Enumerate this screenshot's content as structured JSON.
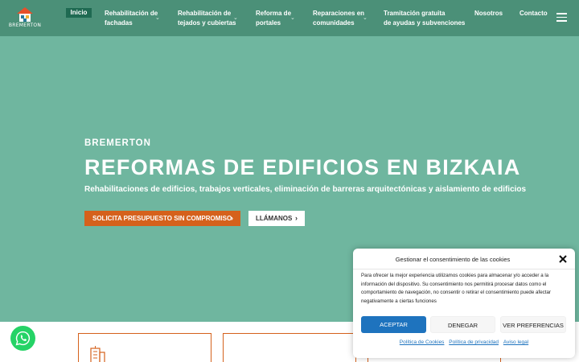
{
  "brand": {
    "logo_text": "BREMERTON"
  },
  "nav": {
    "items": [
      {
        "label": "Inicio",
        "active": true
      },
      {
        "label_line1": "Rehabilitación de",
        "label_line2": "fachadas",
        "has_submenu": true
      },
      {
        "label_line1": "Rehabilitación de",
        "label_line2": "tejados y cubiertas",
        "has_submenu": true
      },
      {
        "label_line1": "Reforma de",
        "label_line2": "portales",
        "has_submenu": true
      },
      {
        "label_line1": "Reparaciones en",
        "label_line2": "comunidades",
        "has_submenu": true
      },
      {
        "label_line1": "Tramitación gratuita",
        "label_line2": "de ayudas y subvenciones",
        "has_submenu": false
      },
      {
        "label": "Nosotros"
      },
      {
        "label": "Contacto"
      }
    ],
    "menu_icon": "hamburger-icon"
  },
  "hero": {
    "eyebrow": "BREMERTON",
    "title": "REFORMAS DE EDIFICIOS EN BIZKAIA",
    "subtitle": "Rehabilitaciones de edificios, trabajos verticales, eliminación de barreras arquitectónicas y aislamiento de edificios",
    "cta_primary": "SOLICITA PRESUPUESTO SIN COMPROMISO",
    "cta_secondary": "LLÁMANOS",
    "arrow": "›"
  },
  "cookie_banner": {
    "title": "Gestionar el consentimiento de las cookies",
    "body": "Para ofrecer la mejor experiencia utilizamos cookies para almacenar y/o acceder a la información del dispositivo. Su consentimiento nos permitirá procesar datos como el comportamiento de navegación, no consentir o retirar el consentimiento puede afectar negativamente a ciertas funciones",
    "accept": "ACEPTAR",
    "deny": "DENEGAR",
    "preferences": "VER PREFERENCIAS",
    "links": [
      "Política de Cookies",
      "Política de privacidad",
      "Aviso legal"
    ]
  },
  "colors": {
    "header": "#4b9078",
    "hero": "#6fb69f",
    "accent_orange": "#d5611c",
    "accept_blue": "#1e73be",
    "whatsapp": "#25d366"
  }
}
